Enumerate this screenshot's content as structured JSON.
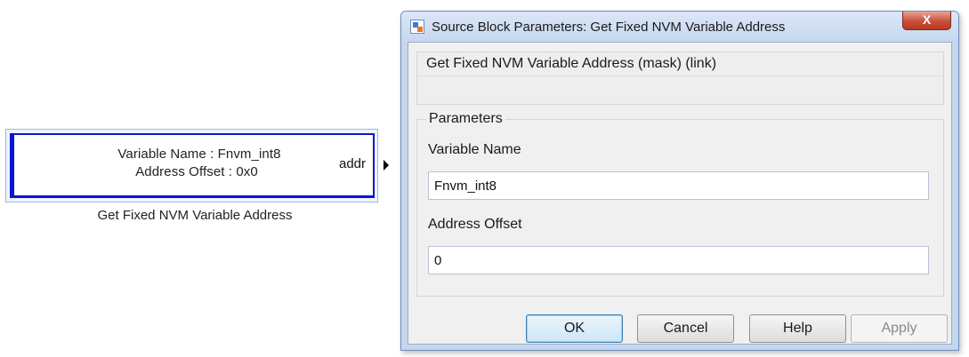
{
  "block": {
    "line1": "Variable Name : Fnvm_int8",
    "line2": "Address Offset : 0x0",
    "port_label": "addr",
    "caption": "Get Fixed NVM Variable Address",
    "border_color": "#0a14d6"
  },
  "dialog": {
    "title": "Source Block Parameters: Get Fixed NVM Variable Address",
    "close_icon": "X",
    "description_title": "Get Fixed NVM Variable Address (mask) (link)",
    "parameters_title": "Parameters",
    "fields": [
      {
        "label": "Variable Name",
        "value": "Fnvm_int8"
      },
      {
        "label": "Address Offset",
        "value": "0"
      }
    ],
    "buttons": {
      "ok": "OK",
      "cancel": "Cancel",
      "help": "Help",
      "apply": "Apply"
    },
    "apply_enabled": false
  },
  "icons": {
    "title_icon": "simulink-block-icon",
    "close": "close-icon",
    "port_arrow": "output-port-arrow-icon"
  }
}
